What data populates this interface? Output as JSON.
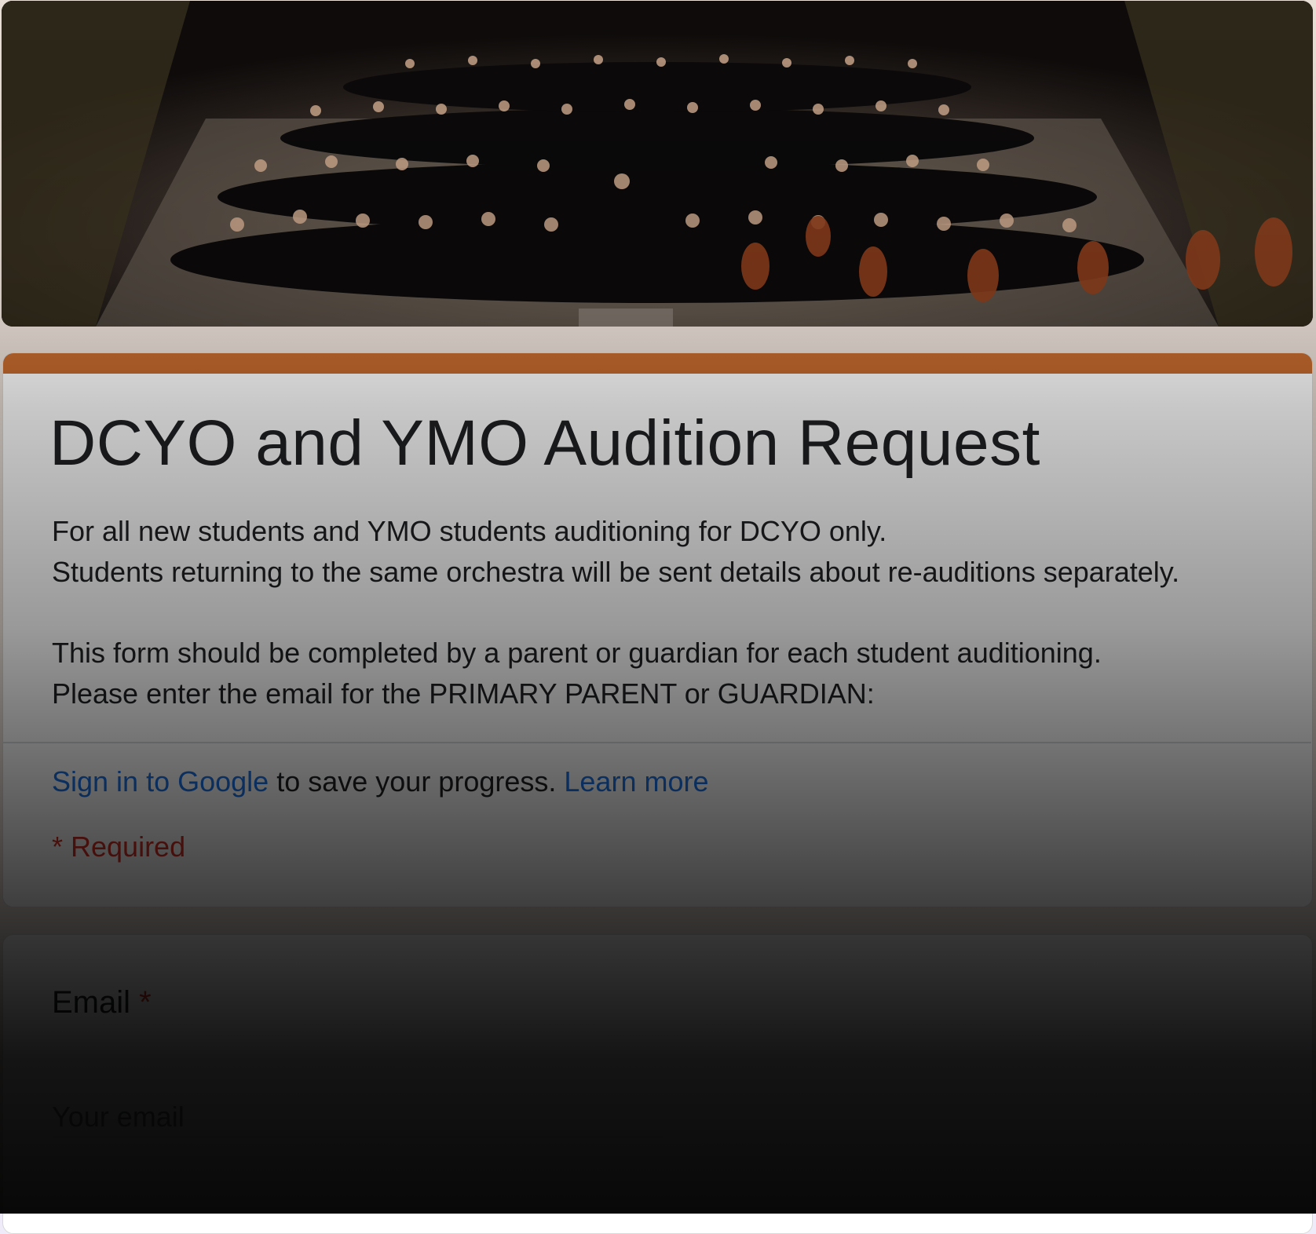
{
  "banner": {
    "alt": "Orchestra group photo on stage"
  },
  "form": {
    "title": "DCYO and YMO Audition Request",
    "description_lines": [
      "For all new students and YMO students auditioning for DCYO only.",
      "Students returning to the same orchestra will be sent details about re-auditions separately.",
      "",
      "This form should be completed by a parent or guardian for each student auditioning.",
      "Please enter the email for the PRIMARY PARENT or GUARDIAN:"
    ],
    "signin_link": "Sign in to Google",
    "signin_text": "to save your progress.",
    "learn_more": "Learn more",
    "required_note": "* Required",
    "accent_color": "#c46a2e"
  },
  "question": {
    "label": "Email",
    "required_star": "*",
    "placeholder": "Your email"
  }
}
